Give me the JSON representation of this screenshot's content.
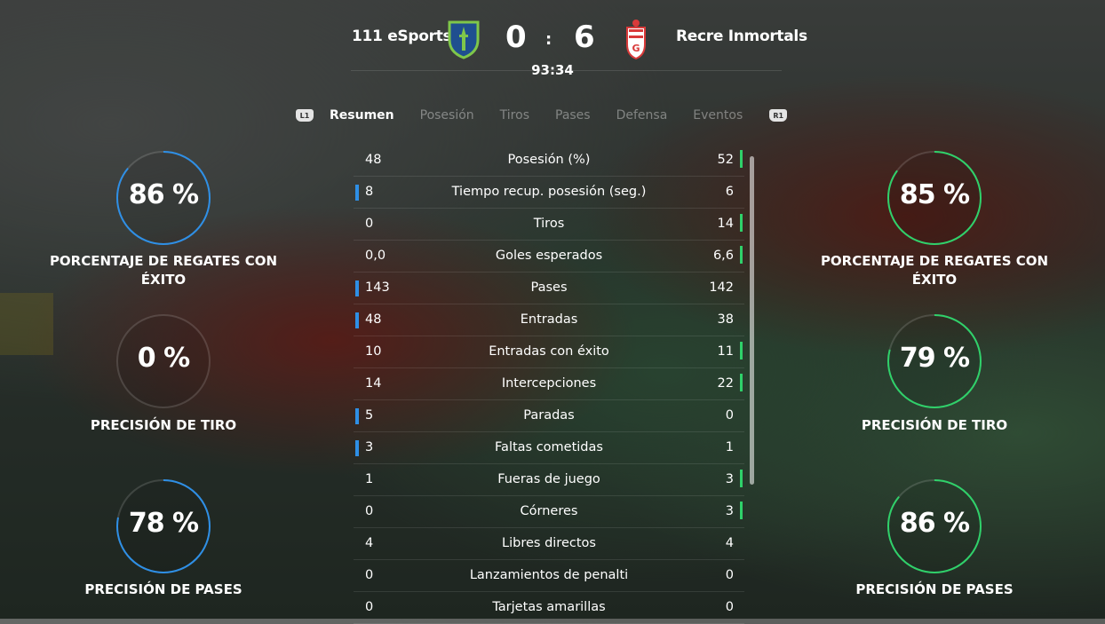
{
  "match": {
    "home_team": "111 eSports",
    "away_team": "Recre Inmortals",
    "home_score": "0",
    "separator": ":",
    "away_score": "6",
    "clock": "93:34",
    "home_crest_icon": "seattle-sounders-crest-icon",
    "away_crest_icon": "granada-crest-icon"
  },
  "tabs": {
    "left_button": "L1",
    "right_button": "R1",
    "items": [
      "Resumen",
      "Posesión",
      "Tiros",
      "Pases",
      "Defensa",
      "Eventos"
    ],
    "active": "Resumen"
  },
  "colors": {
    "home_accent": "#2e8fe6",
    "away_accent": "#2fd16a"
  },
  "stats": [
    {
      "label": "Posesión (%)",
      "home": "48",
      "away": "52",
      "leader": "away"
    },
    {
      "label": "Tiempo recup. posesión (seg.)",
      "home": "8",
      "away": "6",
      "leader": "home"
    },
    {
      "label": "Tiros",
      "home": "0",
      "away": "14",
      "leader": "away"
    },
    {
      "label": "Goles esperados",
      "home": "0,0",
      "away": "6,6",
      "leader": "away"
    },
    {
      "label": "Pases",
      "home": "143",
      "away": "142",
      "leader": "home"
    },
    {
      "label": "Entradas",
      "home": "48",
      "away": "38",
      "leader": "home"
    },
    {
      "label": "Entradas con éxito",
      "home": "10",
      "away": "11",
      "leader": "away"
    },
    {
      "label": "Intercepciones",
      "home": "14",
      "away": "22",
      "leader": "away"
    },
    {
      "label": "Paradas",
      "home": "5",
      "away": "0",
      "leader": "home"
    },
    {
      "label": "Faltas cometidas",
      "home": "3",
      "away": "1",
      "leader": "home"
    },
    {
      "label": "Fueras de juego",
      "home": "1",
      "away": "3",
      "leader": "away"
    },
    {
      "label": "Córneres",
      "home": "0",
      "away": "3",
      "leader": "away"
    },
    {
      "label": "Libres directos",
      "home": "4",
      "away": "4",
      "leader": "none"
    },
    {
      "label": "Lanzamientos de penalti",
      "home": "0",
      "away": "0",
      "leader": "none"
    },
    {
      "label": "Tarjetas amarillas",
      "home": "0",
      "away": "0",
      "leader": "none"
    }
  ],
  "home_rings": [
    {
      "value": "86 %",
      "fraction": 0.86,
      "label": "PORCENTAJE DE REGATES CON ÉXITO"
    },
    {
      "value": "0 %",
      "fraction": 0.0,
      "label": "PRECISIÓN DE TIRO"
    },
    {
      "value": "78 %",
      "fraction": 0.78,
      "label": "PRECISIÓN DE PASES"
    }
  ],
  "away_rings": [
    {
      "value": "85 %",
      "fraction": 0.85,
      "label": "PORCENTAJE DE REGATES CON ÉXITO"
    },
    {
      "value": "79 %",
      "fraction": 0.79,
      "label": "PRECISIÓN DE TIRO"
    },
    {
      "value": "86 %",
      "fraction": 0.86,
      "label": "PRECISIÓN DE PASES"
    }
  ]
}
